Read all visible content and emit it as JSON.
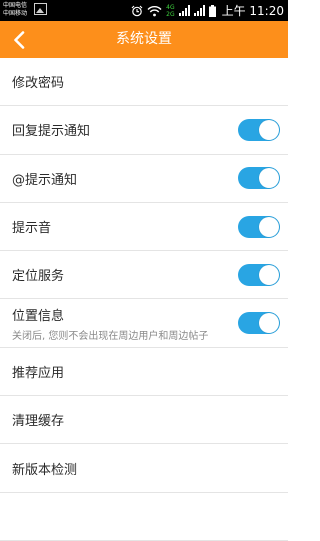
{
  "status_bar": {
    "carrier_1": "中国电信",
    "carrier_2": "中国移动",
    "net_1": "4G",
    "net_2": "2G",
    "time": "上午 11:20",
    "icons": [
      "photo-notification-icon",
      "alarm-icon",
      "wifi-icon",
      "signal-icon",
      "signal-icon",
      "battery-icon"
    ]
  },
  "header": {
    "title": "系统设置",
    "back_icon": "chevron-left-icon",
    "background": "#fd8f1b"
  },
  "settings": {
    "change_password": "修改密码",
    "reply_notify": {
      "label": "回复提示通知",
      "on": true
    },
    "at_notify": {
      "label": "@提示通知",
      "on": true
    },
    "sound": {
      "label": "提示音",
      "on": true
    },
    "location_service": {
      "label": "定位服务",
      "on": true
    },
    "location_info": {
      "label": "位置信息",
      "desc": "关闭后, 您则不会出现在周边用户和周边帖子",
      "on": true
    },
    "recommend_apps": "推荐应用",
    "clear_cache": "清理缓存",
    "check_update": "新版本检测"
  },
  "colors": {
    "toggle_on": "#29a5e3",
    "divider": "#e4e4e4"
  }
}
